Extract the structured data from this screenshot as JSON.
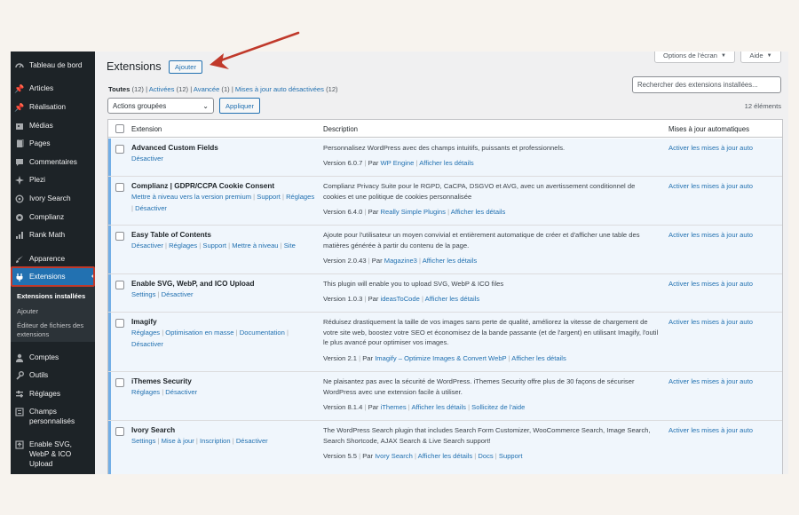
{
  "sidebar": {
    "items": [
      {
        "label": "Tableau de bord",
        "icon": "dashboard-icon"
      },
      {
        "label": "Articles",
        "icon": "pin-icon"
      },
      {
        "label": "Réalisation",
        "icon": "pin-icon"
      },
      {
        "label": "Médias",
        "icon": "media-icon"
      },
      {
        "label": "Pages",
        "icon": "page-icon"
      },
      {
        "label": "Commentaires",
        "icon": "comment-icon"
      },
      {
        "label": "Plezi",
        "icon": "plezi-icon"
      },
      {
        "label": "Ivory Search",
        "icon": "search-icon"
      },
      {
        "label": "Complianz",
        "icon": "shield-icon"
      },
      {
        "label": "Rank Math",
        "icon": "chart-icon"
      },
      {
        "label": "Apparence",
        "icon": "brush-icon"
      },
      {
        "label": "Extensions",
        "icon": "plugin-icon"
      },
      {
        "label": "Comptes",
        "icon": "user-icon"
      },
      {
        "label": "Outils",
        "icon": "wrench-icon"
      },
      {
        "label": "Réglages",
        "icon": "settings-icon"
      },
      {
        "label": "Champs personnalisés",
        "icon": "fields-icon"
      },
      {
        "label": "Enable SVG, WebP & ICO Upload",
        "icon": "upload-icon"
      }
    ],
    "submenu": [
      {
        "label": "Extensions installées"
      },
      {
        "label": "Ajouter"
      },
      {
        "label": "Éditeur de fichiers des extensions"
      }
    ]
  },
  "header": {
    "title": "Extensions",
    "add_button": "Ajouter",
    "screen_options": "Options de l'écran",
    "help": "Aide"
  },
  "filters": {
    "all": "Toutes",
    "all_count": "(12)",
    "active": "Activées",
    "active_count": "(12)",
    "advanced": "Avancée",
    "advanced_count": "(1)",
    "autoupdate_off": "Mises à jour auto désactivées",
    "autoupdate_off_count": "(12)"
  },
  "search": {
    "placeholder": "Rechercher des extensions installées..."
  },
  "bulk": {
    "selected": "Actions groupées",
    "apply": "Appliquer"
  },
  "count_label": "12 éléments",
  "table": {
    "headers": {
      "extension": "Extension",
      "description": "Description",
      "auto": "Mises à jour automatiques"
    },
    "rows": [
      {
        "name": "Advanced Custom Fields",
        "actions": [
          "Désactiver"
        ],
        "desc": "Personnalisez WordPress avec des champs intuitifs, puissants et professionnels.",
        "version": "Version 6.0.7",
        "by": "Par",
        "author": "WP Engine",
        "details": "Afficher les détails",
        "auto": "Activer les mises à jour auto"
      },
      {
        "name": "Complianz | GDPR/CCPA Cookie Consent",
        "actions": [
          "Mettre à niveau vers la version premium",
          "Support",
          "Réglages",
          "Désactiver"
        ],
        "desc": "Complianz Privacy Suite pour le RGPD, CaCPA, DSGVO et AVG, avec un avertissement conditionnel de cookies et une politique de cookies personnalisée",
        "version": "Version 6.4.0",
        "by": "Par",
        "author": "Really Simple Plugins",
        "details": "Afficher les détails",
        "auto": "Activer les mises à jour auto"
      },
      {
        "name": "Easy Table of Contents",
        "actions": [
          "Désactiver",
          "Réglages",
          "Support",
          "Mettre à niveau",
          "Site"
        ],
        "desc": "Ajoute pour l'utilisateur un moyen convivial et entièrement automatique de créer et d'afficher une table des matières générée à partir du contenu de la page.",
        "version": "Version 2.0.43",
        "by": "Par",
        "author": "Magazine3",
        "details": "Afficher les détails",
        "auto": "Activer les mises à jour auto"
      },
      {
        "name": "Enable SVG, WebP, and ICO Upload",
        "actions": [
          "Settings",
          "Désactiver"
        ],
        "desc": "This plugin will enable you to upload SVG, WebP & ICO files",
        "version": "Version 1.0.3",
        "by": "Par",
        "author": "ideasToCode",
        "details": "Afficher les détails",
        "auto": "Activer les mises à jour auto"
      },
      {
        "name": "Imagify",
        "actions": [
          "Réglages",
          "Optimisation en masse",
          "Documentation",
          "Désactiver"
        ],
        "desc": "Réduisez drastiquement la taille de vos images sans perte de qualité, améliorez la vitesse de chargement de votre site web, boostez votre SEO et économisez de la bande passante (et de l'argent) en utilisant Imagify, l'outil le plus avancé pour optimiser vos images.",
        "version": "Version 2.1",
        "by": "Par",
        "author": "Imagify – Optimize Images & Convert WebP",
        "details": "Afficher les détails",
        "auto": "Activer les mises à jour auto"
      },
      {
        "name": "iThemes Security",
        "actions": [
          "Réglages",
          "Désactiver"
        ],
        "desc": "Ne plaisantez pas avec la sécurité de WordPress. iThemes Security offre plus de 30 façons de sécuriser WordPress avec une extension facile à utiliser.",
        "version": "Version 8.1.4",
        "by": "Par",
        "author": "iThemes",
        "details": "Afficher les détails",
        "extra": "Sollicitez de l'aide",
        "auto": "Activer les mises à jour auto"
      },
      {
        "name": "Ivory Search",
        "actions": [
          "Settings",
          "Mise à jour",
          "Inscription",
          "Désactiver"
        ],
        "desc": "The WordPress Search plugin that includes Search Form Customizer, WooCommerce Search, Image Search, Search Shortcode, AJAX Search & Live Search support!",
        "version": "Version 5.5",
        "by": "Par",
        "author": "Ivory Search",
        "details": "Afficher les détails",
        "extra": "Docs",
        "extra2": "Support",
        "auto": "Activer les mises à jour auto"
      }
    ]
  },
  "colors": {
    "accent": "#2271b1",
    "sidebar": "#1d2327",
    "annotation": "#c0392b"
  }
}
